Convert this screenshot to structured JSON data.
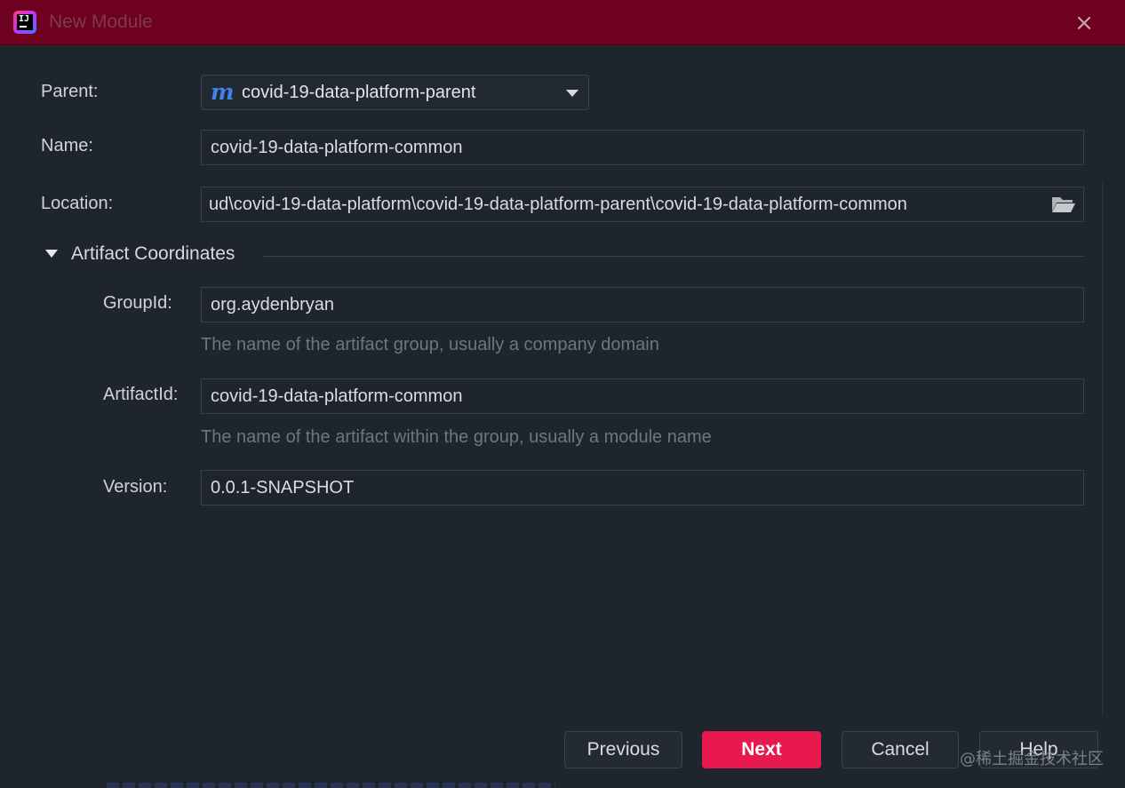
{
  "window": {
    "title": "New Module",
    "close_icon": "×"
  },
  "form": {
    "parent_label": "Parent:",
    "parent_value": "covid-19-data-platform-parent",
    "parent_icon_glyph": "m",
    "name_label": "Name:",
    "name_value": "covid-19-data-platform-common",
    "location_label": "Location:",
    "location_value": "ud\\covid-19-data-platform\\covid-19-data-platform-parent\\covid-19-data-platform-common"
  },
  "artifact": {
    "section_title": "Artifact Coordinates",
    "group_label": "GroupId:",
    "group_value": "org.aydenbryan",
    "group_hint": "The name of the artifact group, usually a company domain",
    "artifact_label": "ArtifactId:",
    "artifact_value": "covid-19-data-platform-common",
    "artifact_hint": "The name of the artifact within the group, usually a module name",
    "version_label": "Version:",
    "version_value": "0.0.1-SNAPSHOT"
  },
  "buttons": {
    "previous": "Previous",
    "next": "Next",
    "cancel": "Cancel",
    "help": "Help"
  },
  "watermark": "@稀土掘金技术社区",
  "colors": {
    "titlebar": "#6e0020",
    "background": "#1f252d",
    "primary_button": "#e8194e",
    "maven_icon": "#3d84e6"
  }
}
